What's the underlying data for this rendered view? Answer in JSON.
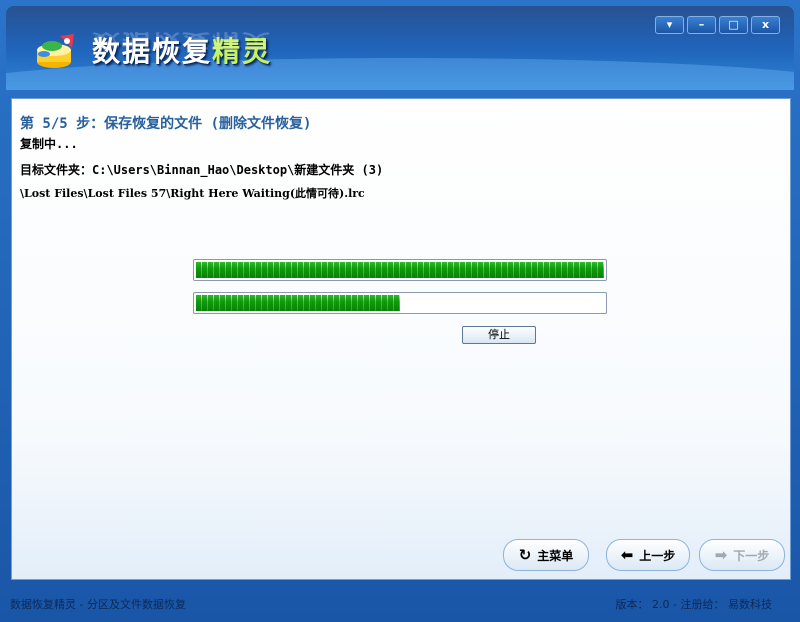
{
  "header": {
    "title_main": "数据恢复",
    "title_accent": "精灵",
    "controls": {
      "dropdown": "▾",
      "minimize": "–",
      "maximize": "□",
      "close": "x"
    }
  },
  "wizard": {
    "step_title": "第 5/5 步：保存恢复的文件 (删除文件恢复)",
    "status_text": "复制中...",
    "target_folder": "目标文件夹：C:\\Users\\Binnan_Hao\\Desktop\\新建文件夹 (3)",
    "current_file": "\\Lost Files\\Lost Files 57\\Right Here Waiting(此情可待).lrc",
    "progress_file": 1.0,
    "progress_total": 0.5,
    "stop_label": "停止"
  },
  "nav": {
    "main_menu_label": "主菜单",
    "prev_label": "上一步",
    "next_label": "下一步"
  },
  "statusbar": {
    "left": "数据恢复精灵 - 分区及文件数据恢复",
    "right": "版本： 2.0 - 注册给： 易数科技"
  },
  "icons": {
    "logo": "data-recovery-logo",
    "main_menu": "refresh-icon",
    "prev": "arrow-left-icon",
    "next": "arrow-right-icon"
  }
}
